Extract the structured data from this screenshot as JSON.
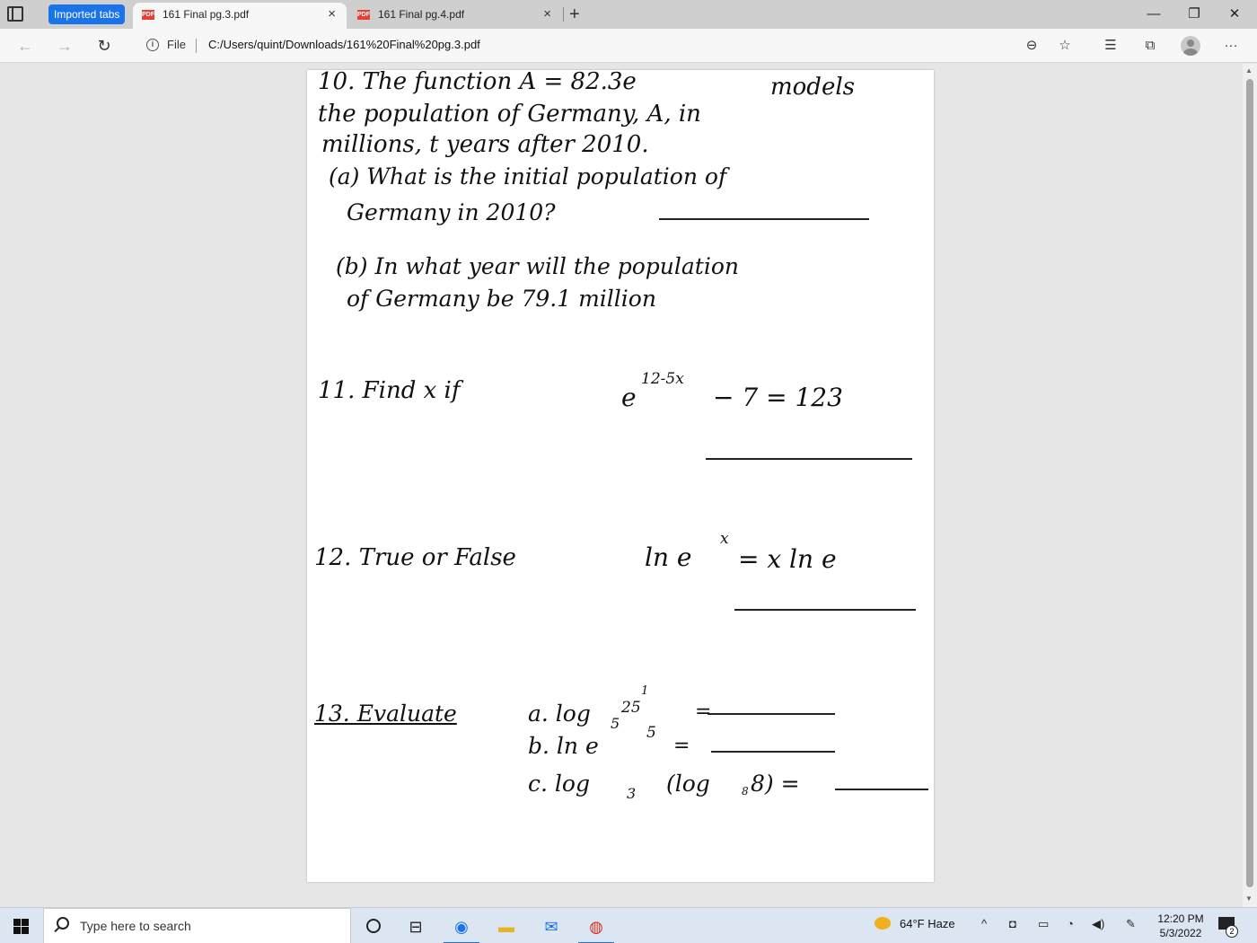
{
  "browser": {
    "tab_group_label": "Imported tabs",
    "tabs": [
      {
        "title": "161 Final pg.3.pdf",
        "active": true
      },
      {
        "title": "161 Final pg.4.pdf",
        "active": false
      }
    ],
    "tab_close_glyph": "×",
    "new_tab_glyph": "+",
    "window_controls": {
      "minimize": "—",
      "restore": "❐",
      "close": "✕"
    },
    "site_label": "File",
    "url": "C:/Users/quint/Downloads/161%20Final%20pg.3.pdf",
    "icons": [
      "back-icon",
      "forward-icon",
      "refresh-icon",
      "info-icon",
      "zoom-out-icon",
      "add-favorite-icon",
      "favorites-icon",
      "collections-icon",
      "profile-icon",
      "more-icon"
    ]
  },
  "document": {
    "q10": {
      "line1": "10. The function  A = 82.3e",
      "line1b": "models",
      "line2": "the population of Germany, A, in",
      "line3": "millions, t years after 2010.",
      "a": "(a) What is the initial population of",
      "a2": "Germany in 2010?",
      "b": "(b) In what year will the population",
      "b2": "of Germany be 79.1 million"
    },
    "q11": {
      "prefix": "11. Find  x   if",
      "base": "e",
      "exponent": "12-5x",
      "rest": "− 7 = 123"
    },
    "q12": {
      "prefix": "12. True or False",
      "lhs": "ln e",
      "lhs_exp": "x",
      "rhs": "= x ln e"
    },
    "q13": {
      "label": "13. Evaluate",
      "a_prefix": "a. log",
      "a_base": "5",
      "a_arg": "25",
      "a_exp": "1",
      "a_eq": "=",
      "b_prefix": "b. ln e",
      "b_exp": "5",
      "b_eq": "=",
      "c_prefix": "c. log",
      "c_base": "3",
      "c_inner": "(log",
      "c_inner_base": "8",
      "c_inner_arg": "8) ="
    }
  },
  "taskbar": {
    "search_placeholder": "Type here to search",
    "weather": "64°F  Haze",
    "time": "12:20 PM",
    "date": "5/3/2022",
    "notifications": "2",
    "accent": "#1a73e8"
  }
}
